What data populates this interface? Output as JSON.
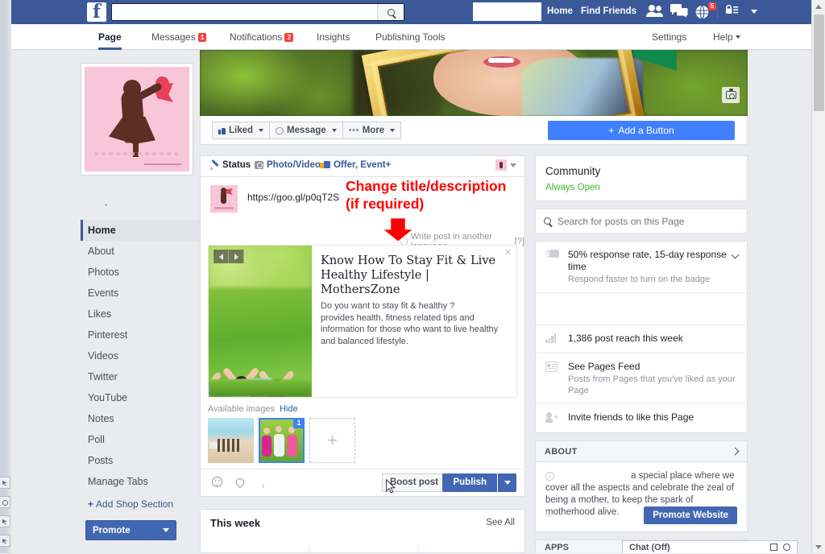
{
  "topbar": {
    "logo": "f",
    "search_value": "",
    "search_placeholder": "",
    "search_icon": "search-icon",
    "account_name": "",
    "links": [
      {
        "label": "Home"
      },
      {
        "label": "Find Friends"
      }
    ],
    "icons": [
      {
        "name": "friend-requests-icon",
        "badge": ""
      },
      {
        "name": "messages-icon",
        "badge": ""
      },
      {
        "name": "notifications-globe-icon",
        "badge": "5"
      },
      {
        "name": "privacy-shortcuts-icon",
        "badge": ""
      }
    ]
  },
  "pagebar": {
    "tabs": [
      {
        "label": "Page",
        "badge": "",
        "active": true
      },
      {
        "label": "Messages",
        "badge": "1",
        "active": false
      },
      {
        "label": "Notifications",
        "badge": "2",
        "active": false
      },
      {
        "label": "Insights",
        "badge": "",
        "active": false
      },
      {
        "label": "Publishing Tools",
        "badge": "",
        "active": false
      }
    ],
    "settings_label": "Settings",
    "help_label": "Help"
  },
  "cover": {
    "camera_button": "update-cover-photo-button"
  },
  "actionbar": {
    "liked_label": "Liked",
    "message_label": "Message",
    "more_label": "More",
    "add_button_label": "Add a Button"
  },
  "sidebar": {
    "items": [
      {
        "label": "Home",
        "active": true
      },
      {
        "label": "About",
        "active": false
      },
      {
        "label": "Photos",
        "active": false
      },
      {
        "label": "Events",
        "active": false
      },
      {
        "label": "Likes",
        "active": false
      },
      {
        "label": "Pinterest",
        "active": false
      },
      {
        "label": "Videos",
        "active": false
      },
      {
        "label": "Twitter",
        "active": false
      },
      {
        "label": "YouTube",
        "active": false
      },
      {
        "label": "Notes",
        "active": false
      },
      {
        "label": "Poll",
        "active": false
      },
      {
        "label": "Posts",
        "active": false
      },
      {
        "label": "Manage Tabs",
        "active": false
      }
    ],
    "add_shop_label": "Add Shop Section",
    "add_shop_plus": "+",
    "promote_label": "Promote"
  },
  "composer": {
    "tabs": [
      {
        "label": "Status",
        "icon": "pencil-icon",
        "active": true
      },
      {
        "label": "Photo/Video",
        "icon": "camera-icon",
        "active": false
      },
      {
        "label": "Offer, Event+",
        "icon": "offer-icon",
        "active": false
      }
    ],
    "url_text": "https://goo.gl/p0qT2S",
    "translate_label": "Write post in another language",
    "translate_help": "[?]",
    "annotation_line1": "Change title/description",
    "annotation_line2": "(if required)",
    "link_card": {
      "title": "Know How To Stay Fit & Live Healthy Lifestyle | MothersZone",
      "description": "Do you want to stay fit & healthy ?\nprovides health, fitness related tips and information for those who want to live healthy and balanced lifestyle.",
      "close_icon": "close-icon",
      "prev_icon": "prev-arrow-icon",
      "next_icon": "next-arrow-icon"
    },
    "available_images_label": "Available images",
    "hide_label": "Hide",
    "thumbnails": [
      {
        "name": "thumbnail-beach",
        "number": "",
        "selected": false
      },
      {
        "name": "thumbnail-yoga",
        "number": "1",
        "selected": true
      }
    ],
    "add_image_label": "+",
    "footer": {
      "emoji_icon": "emoji-icon",
      "location_icon": "location-pin-icon",
      "boost_label": "Boost post",
      "publish_label": "Publish",
      "publish_caret": "publish-dropdown-caret"
    }
  },
  "thisweek": {
    "title": "This week",
    "see_all_label": "See All"
  },
  "rightcol": {
    "community": {
      "title": "Community",
      "status": "Always Open"
    },
    "search_placeholder": "Search for posts on this Page",
    "rows": [
      {
        "icon": "response-rate-icon",
        "title": "50% response rate, 15-day response time",
        "sub": "Respond faster to turn on the badge",
        "chevron": true
      },
      {
        "icon": "post-reach-icon",
        "title": "1,386 post reach this week",
        "sub": "",
        "chevron": false
      },
      {
        "icon": "pages-feed-icon",
        "title": "See Pages Feed",
        "sub": "Posts from Pages that you've liked as your Page",
        "chevron": false
      },
      {
        "icon": "invite-friends-icon",
        "title": "Invite friends to like this Page",
        "sub": "",
        "chevron": false
      }
    ],
    "about": {
      "header_label": "ABOUT",
      "text": "a special place where we cover all the aspects and celebrate the zeal of being a mother, to keep the spark of motherhood alive.",
      "promote_website_label": "Promote Website"
    },
    "apps_label": "APPS"
  },
  "chatbar": {
    "label": "Chat (Off)",
    "compose_icon": "compose-icon",
    "settings_icon": "gear-icon"
  },
  "colors": {
    "fb_blue": "#3b5998",
    "button_blue": "#4267b2",
    "cta_blue": "#4080ff",
    "badge_red": "#fa3e3e",
    "annotation_red": "#ff0000",
    "green_status": "#42b72a",
    "page_bg": "#e9ebee"
  }
}
